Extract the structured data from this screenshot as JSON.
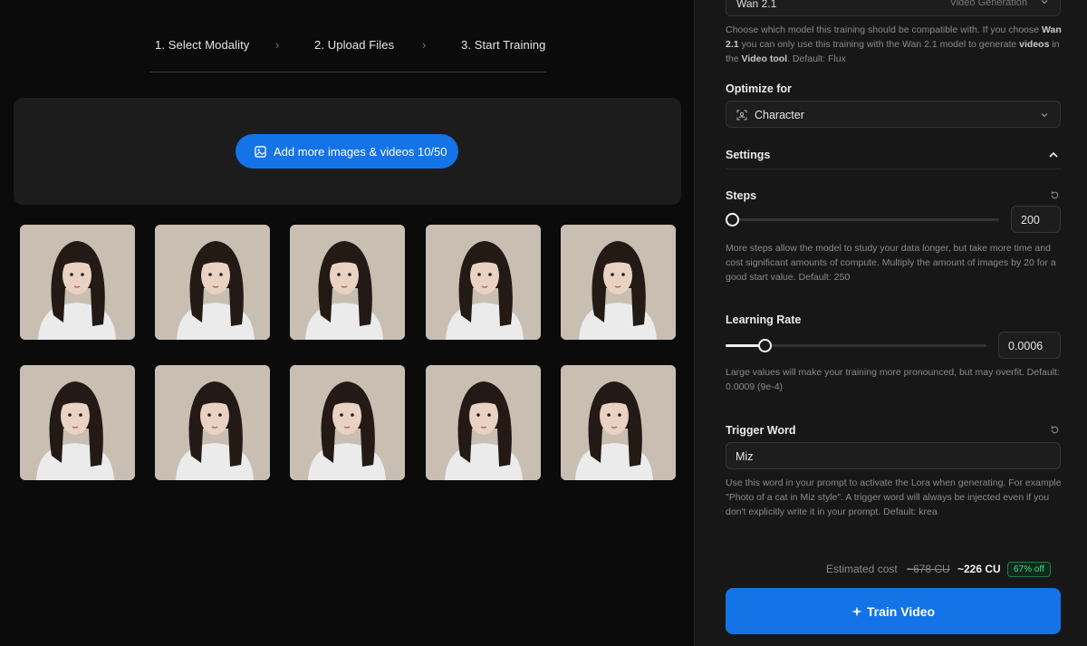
{
  "steps": [
    {
      "label": "1. Select Modality"
    },
    {
      "label": "2. Upload Files"
    },
    {
      "label": "3. Start Training"
    }
  ],
  "upload": {
    "button_label": "Add more images & videos 10/50",
    "image_count": 10
  },
  "model": {
    "value": "Wan 2.1",
    "tag": "Video Generation",
    "help_pre": "Choose which model this training should be compatible with. If you choose ",
    "help_b1": "Wan 2.1",
    "help_mid": " you can only use this training with the Wan 2.1 model to generate ",
    "help_b2": "videos",
    "help_mid2": " in the ",
    "help_b3": "Video tool",
    "help_post": ". Default: Flux"
  },
  "optimize": {
    "label": "Optimize for",
    "value": "Character"
  },
  "settings": {
    "label": "Settings"
  },
  "steps_setting": {
    "label": "Steps",
    "value": "200",
    "fraction": 0.0,
    "help": "More steps allow the model to study your data longer, but take more time and cost significant amounts of compute. Multiply the amount of images by 20 for a good start value. Default: 250"
  },
  "learning_rate": {
    "label": "Learning Rate",
    "value": "0.0006",
    "fraction": 0.15,
    "help": "Large values will make your training more pronounced, but may overfit. Default: 0.0009 (9e-4)"
  },
  "trigger_word": {
    "label": "Trigger Word",
    "value": "Miz",
    "help": "Use this word in your prompt to activate the Lora when generating. For example \"Photo of a cat in Miz style\". A trigger word will always be injected even if you don't explicitly write it in your prompt. Default: krea"
  },
  "cost": {
    "label": "Estimated cost",
    "old": "~678 CU",
    "new": "~226 CU",
    "discount": "67% off"
  },
  "train": {
    "label": "Train Video"
  },
  "colors": {
    "accent": "#1473e6",
    "discount": "#3ddc84"
  }
}
